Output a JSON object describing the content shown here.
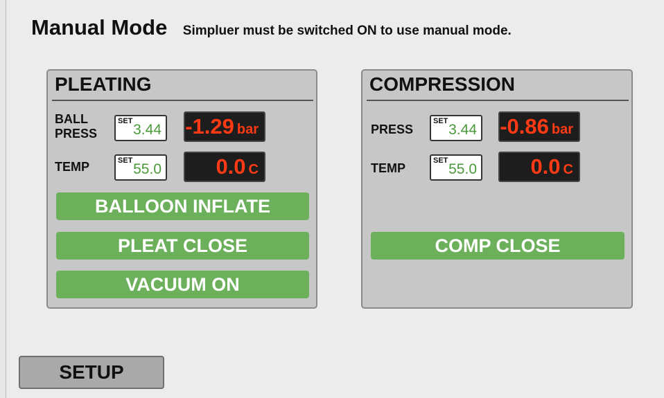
{
  "header": {
    "title": "Manual Mode",
    "subtitle": "Simpluer must be switched ON to use manual mode."
  },
  "pleating": {
    "title": "PLEATING",
    "ball_press": {
      "label_line1": "BALL",
      "label_line2": "PRESS",
      "set_tag": "SET",
      "set_value": "3.44",
      "reading": "-1.29",
      "unit": "bar"
    },
    "temp": {
      "label": "TEMP",
      "set_tag": "SET",
      "set_value": "55.0",
      "reading": "0.0",
      "unit": "C"
    },
    "buttons": {
      "balloon_inflate": "BALLOON INFLATE",
      "pleat_close": "PLEAT CLOSE",
      "vacuum_on": "VACUUM ON"
    }
  },
  "compression": {
    "title": "COMPRESSION",
    "press": {
      "label": "PRESS",
      "set_tag": "SET",
      "set_value": "3.44",
      "reading": "-0.86",
      "unit": "bar"
    },
    "temp": {
      "label": "TEMP",
      "set_tag": "SET",
      "set_value": "55.0",
      "reading": "0.0",
      "unit": "C"
    },
    "buttons": {
      "comp_close": "COMP CLOSE"
    }
  },
  "footer": {
    "setup_label": "SETUP"
  },
  "colors": {
    "background": "#ececec",
    "panel": "#c7c7c7",
    "button_green": "#6cb05b",
    "readout_bg": "#1d1d1d",
    "readout_text": "#ff3a14",
    "set_value_text": "#4b9a3a"
  }
}
